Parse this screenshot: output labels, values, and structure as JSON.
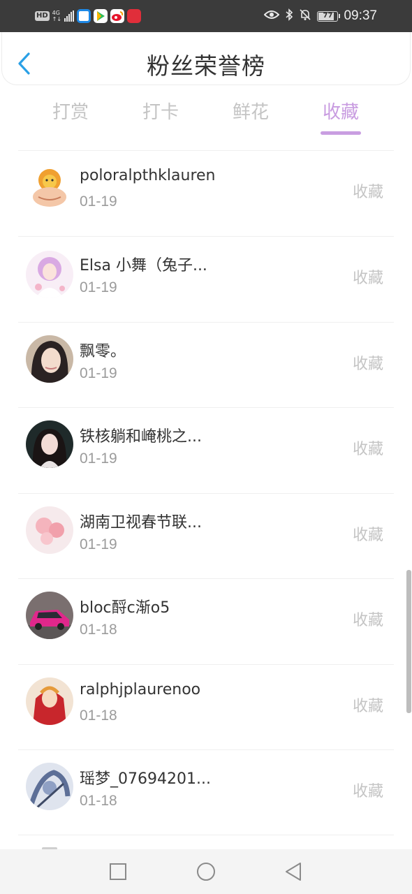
{
  "status_bar": {
    "network_tag": "HD",
    "network_type": "4G",
    "time": "09:37",
    "battery_level": "77",
    "icons": [
      "signal-icon",
      "app-icon-browser",
      "app-icon-video",
      "app-icon-weibo",
      "app-icon-shop",
      "eye-icon",
      "bluetooth-icon",
      "bell-off-icon",
      "battery-icon"
    ]
  },
  "header": {
    "title": "粉丝荣誉榜",
    "back_icon": "chevron-left-icon"
  },
  "tabs": [
    {
      "label": "打赏",
      "active": false
    },
    {
      "label": "打卡",
      "active": false
    },
    {
      "label": "鲜花",
      "active": false
    },
    {
      "label": "收藏",
      "active": true
    }
  ],
  "list": {
    "items": [
      {
        "name": "poloralpthklauren",
        "date": "01-19",
        "action": "收藏",
        "avatar": "cartoon-lion-avatar"
      },
      {
        "name": "Elsa 小舞（兔子...",
        "date": "01-19",
        "action": "收藏",
        "avatar": "anime-girl-avatar"
      },
      {
        "name": "飘零。",
        "date": "01-19",
        "action": "收藏",
        "avatar": "portrait-photo-avatar"
      },
      {
        "name": "铁核躺和崦桃之...",
        "date": "01-19",
        "action": "收藏",
        "avatar": "portrait-photo-avatar"
      },
      {
        "name": "湖南卫视春节联...",
        "date": "01-19",
        "action": "收藏",
        "avatar": "pink-balloons-avatar"
      },
      {
        "name": "bloc酹c渐o5",
        "date": "01-18",
        "action": "收藏",
        "avatar": "pink-car-avatar"
      },
      {
        "name": "ralphjplaurenoo",
        "date": "01-18",
        "action": "收藏",
        "avatar": "anime-character-avatar"
      },
      {
        "name": "瑶梦_07694201...",
        "date": "01-18",
        "action": "收藏",
        "avatar": "blue-sketch-avatar"
      }
    ]
  },
  "colors": {
    "accent": "#c89be0",
    "status_bar": "#3b3b3b",
    "text_primary": "#333333",
    "text_secondary": "#9b9b9b",
    "text_muted": "#c4c4c4",
    "back_arrow": "#2aa0e6"
  },
  "navigation_bar": {
    "buttons": [
      "recents-square-icon",
      "home-circle-icon",
      "back-triangle-icon"
    ]
  }
}
